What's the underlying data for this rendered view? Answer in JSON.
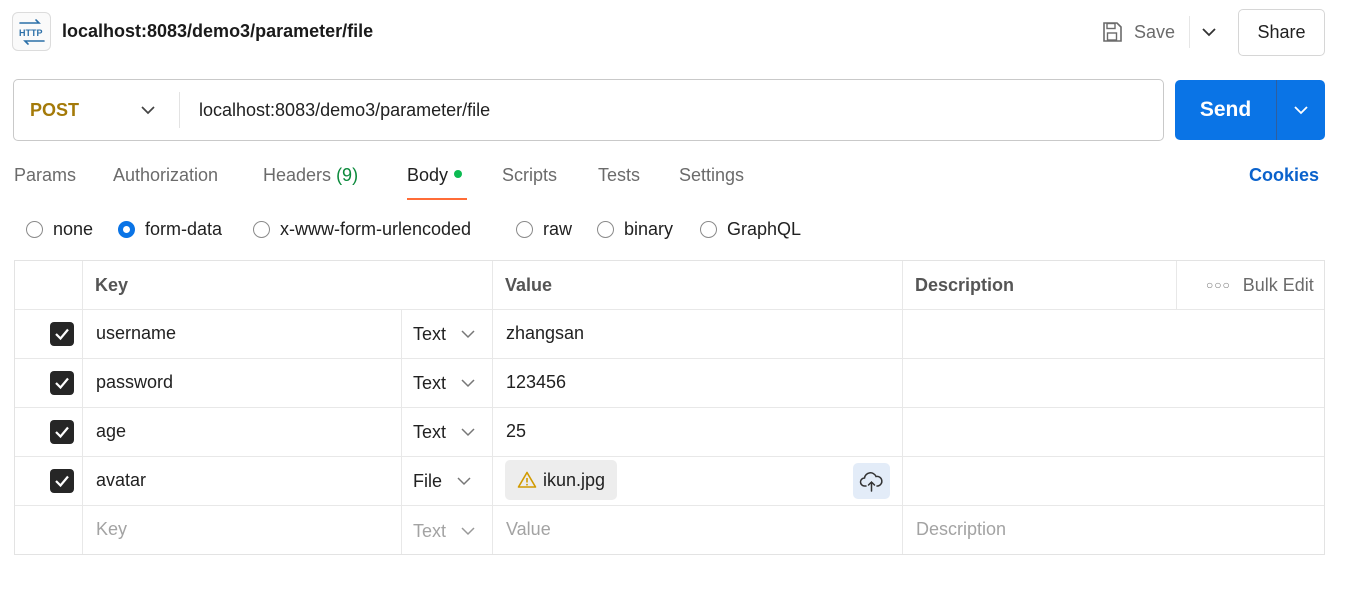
{
  "header": {
    "app_icon_text": "HTTP",
    "title": "localhost:8083/demo3/parameter/file",
    "save_label": "Save",
    "share_label": "Share"
  },
  "request": {
    "method": "POST",
    "url": "localhost:8083/demo3/parameter/file",
    "send_label": "Send"
  },
  "tabs": {
    "params": "Params",
    "authorization": "Authorization",
    "headers_label": "Headers",
    "headers_count": "(9)",
    "body": "Body",
    "scripts": "Scripts",
    "tests": "Tests",
    "settings": "Settings",
    "cookies": "Cookies",
    "active": "Body"
  },
  "body_types": {
    "none": "none",
    "form_data": "form-data",
    "urlencoded": "x-www-form-urlencoded",
    "raw": "raw",
    "binary": "binary",
    "graphql": "GraphQL",
    "selected": "form-data"
  },
  "table": {
    "headers": {
      "key": "Key",
      "value": "Value",
      "description": "Description",
      "bulk_edit": "Bulk Edit"
    },
    "rows": [
      {
        "checked": true,
        "key": "username",
        "type": "Text",
        "value": "zhangsan",
        "description": ""
      },
      {
        "checked": true,
        "key": "password",
        "type": "Text",
        "value": "123456",
        "description": ""
      },
      {
        "checked": true,
        "key": "age",
        "type": "Text",
        "value": "25",
        "description": ""
      },
      {
        "checked": true,
        "key": "avatar",
        "type": "File",
        "value": "ikun.jpg",
        "description": ""
      }
    ],
    "placeholder_row": {
      "key": "Key",
      "type": "Text",
      "value": "Value",
      "description": "Description"
    }
  },
  "colors": {
    "method": "#a47a09",
    "send": "#0a74e6",
    "tab_underline": "#ff6c37",
    "headers_count": "#0c8a3c",
    "body_dot": "#0cbb52",
    "cookies": "#0a62cc",
    "warning": "#d19a00"
  }
}
